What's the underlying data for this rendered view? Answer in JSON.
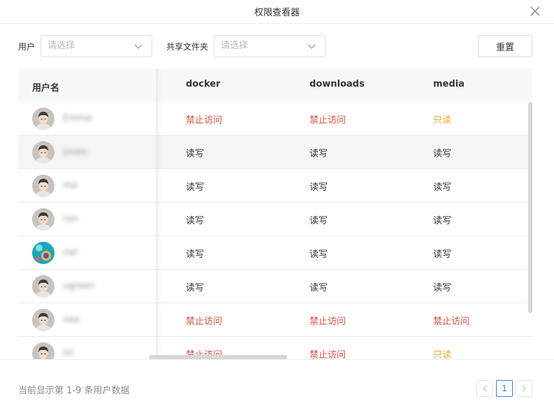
{
  "dialog": {
    "title": "权限查看器",
    "close_icon": "close-icon"
  },
  "filters": {
    "user_label": "用户",
    "user_placeholder": "请选择",
    "folder_label": "共享文件夹",
    "folder_placeholder": "请选择",
    "reset_label": "重置"
  },
  "table": {
    "headers": [
      "用户名",
      "docker",
      "downloads",
      "media"
    ],
    "rows": [
      {
        "name": "Emma",
        "avatar": "default-avatar",
        "perms": [
          "禁止访问",
          "禁止访问",
          "只读"
        ]
      },
      {
        "name": "josen",
        "avatar": "default-avatar",
        "perms": [
          "读写",
          "读写",
          "读写"
        ]
      },
      {
        "name": "ma",
        "avatar": "default-avatar",
        "perms": [
          "读写",
          "读写",
          "读写"
        ]
      },
      {
        "name": "ran",
        "avatar": "default-avatar",
        "perms": [
          "读写",
          "读写",
          "读写"
        ]
      },
      {
        "name": "zwl",
        "avatar": "custom-avatar",
        "perms": [
          "读写",
          "读写",
          "读写"
        ]
      },
      {
        "name": "ugreen",
        "avatar": "default-avatar",
        "perms": [
          "读写",
          "读写",
          "读写"
        ]
      },
      {
        "name": "aaa",
        "avatar": "default-avatar",
        "perms": [
          "禁止访问",
          "禁止访问",
          "禁止访问"
        ]
      },
      {
        "name": "lol",
        "avatar": "default-avatar",
        "perms": [
          "禁止访问",
          "禁止访问",
          "只读"
        ]
      }
    ],
    "highlight_row": 1
  },
  "footer": {
    "summary": "当前显示第 1-9 条用户数据",
    "current_page": "1"
  },
  "colors": {
    "deny": "#e24a3b",
    "readonly": "#f5a623",
    "readwrite": "#333333",
    "accent": "#3a7bd5"
  }
}
